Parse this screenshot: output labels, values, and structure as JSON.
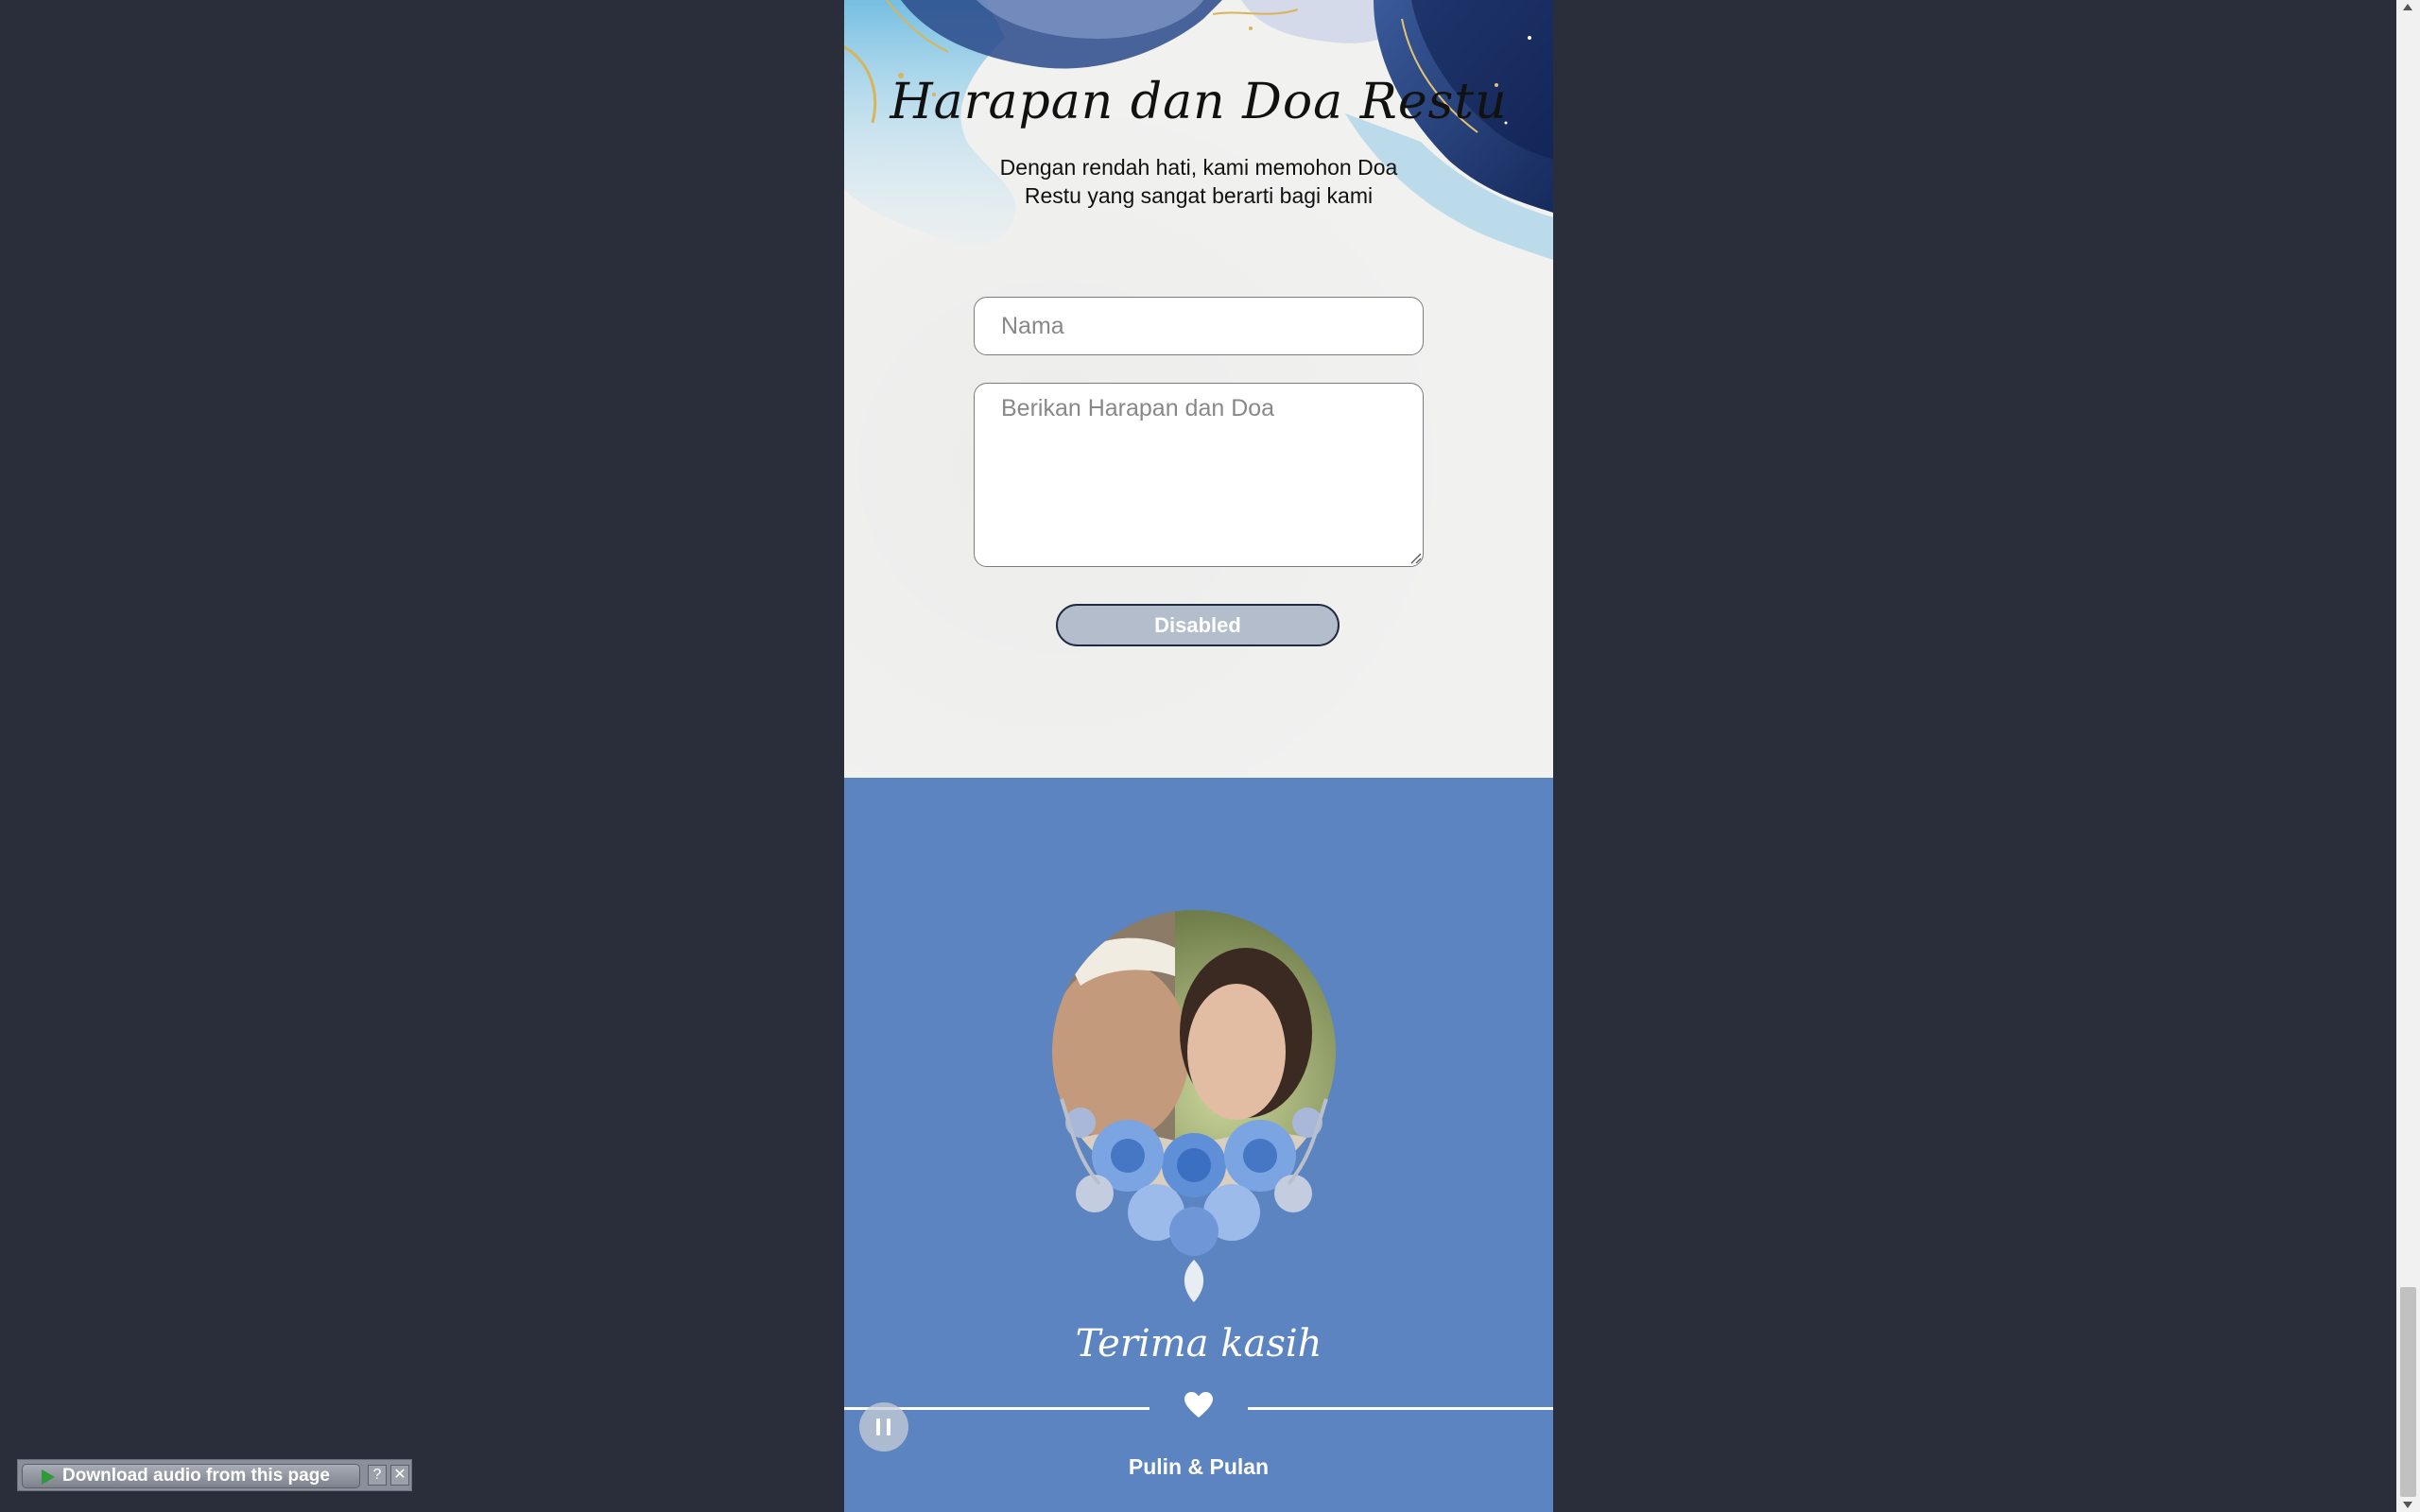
{
  "wishes": {
    "title": "Harapan dan Doa Restu",
    "subtitle": "Dengan rendah hati, kami memohon Doa Restu yang sangat berarti bagi kami",
    "name_placeholder": "Nama",
    "message_placeholder": "Berikan Harapan dan Doa",
    "submit_label": "Disabled"
  },
  "footer": {
    "thanks": "Terima kasih",
    "couple": "Pulin & Pulan"
  },
  "audio_bar": {
    "label": "Download audio from this page",
    "help": "?",
    "close": "✕"
  },
  "colors": {
    "page_bg": "#2a2e3a",
    "footer_bg": "#5c84c0",
    "navy": "#1e3366",
    "sky": "#8ec9e6",
    "button_bg": "#b4bdcc"
  }
}
